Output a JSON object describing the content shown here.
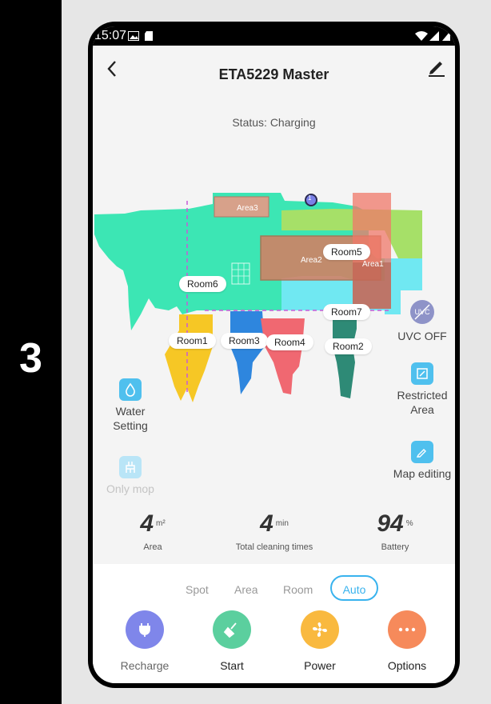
{
  "step_number": "3",
  "status_bar": {
    "time": "15:07"
  },
  "header": {
    "title": "ETA5229 Master"
  },
  "status_text": "Status: Charging",
  "map": {
    "room_labels": [
      "Room5",
      "Room6",
      "Room7",
      "Room1",
      "Room3",
      "Room4",
      "Room2"
    ],
    "area_labels": [
      "Area3",
      "Area2",
      "Area1"
    ],
    "robot_marker": "1"
  },
  "left_controls": {
    "water_setting": "Water Setting",
    "only_mop": "Only mop"
  },
  "right_controls": {
    "uvc": "UVC OFF",
    "uvc_icon_text": "UVC",
    "restricted_area": "Restricted Area",
    "map_editing": "Map editing"
  },
  "stats": {
    "area": {
      "value": "4",
      "unit": "m²",
      "label": "Area"
    },
    "times": {
      "value": "4",
      "unit": "min",
      "label": "Total cleaning times"
    },
    "battery": {
      "value": "94",
      "unit": "%",
      "label": "Battery"
    }
  },
  "modes": [
    "Spot",
    "Area",
    "Room",
    "Auto"
  ],
  "selected_mode": "Auto",
  "actions": {
    "recharge": "Recharge",
    "start": "Start",
    "power": "Power",
    "options": "Options"
  },
  "colors": {
    "accent": "#39b3ee",
    "recharge": "#7f86ea",
    "start": "#5bcf9e",
    "power": "#f9b93f",
    "options": "#f68a5b",
    "map_main": "#3ce6b4"
  }
}
